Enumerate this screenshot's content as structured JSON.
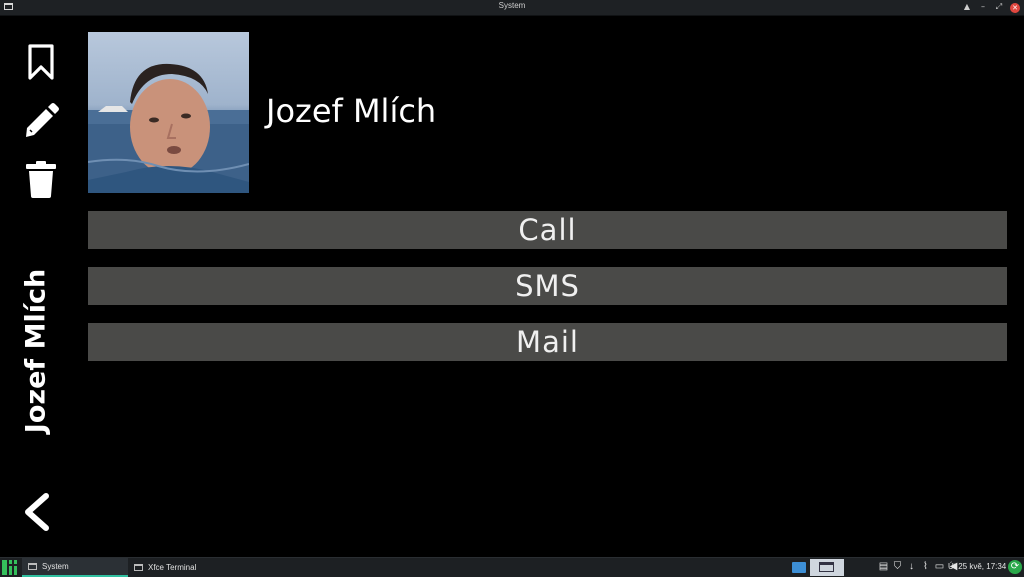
{
  "window": {
    "title": "System"
  },
  "contact": {
    "name": "Jozef Mlích"
  },
  "sidebar": {
    "icons": [
      "bookmark-icon",
      "pencil-icon",
      "trash-icon",
      "chevron-left-icon"
    ],
    "vertical_name": "Jozef Mlích"
  },
  "actions": [
    {
      "label": "Call"
    },
    {
      "label": "SMS"
    },
    {
      "label": "Mail"
    }
  ],
  "taskbar": {
    "tasks": [
      {
        "label": "System"
      },
      {
        "label": "Xfce Terminal"
      }
    ],
    "clock": "Út 25 kvě, 17:34"
  },
  "colors": {
    "background": "#000000",
    "button": "#4a4a48",
    "accent": "#35bf5c"
  }
}
